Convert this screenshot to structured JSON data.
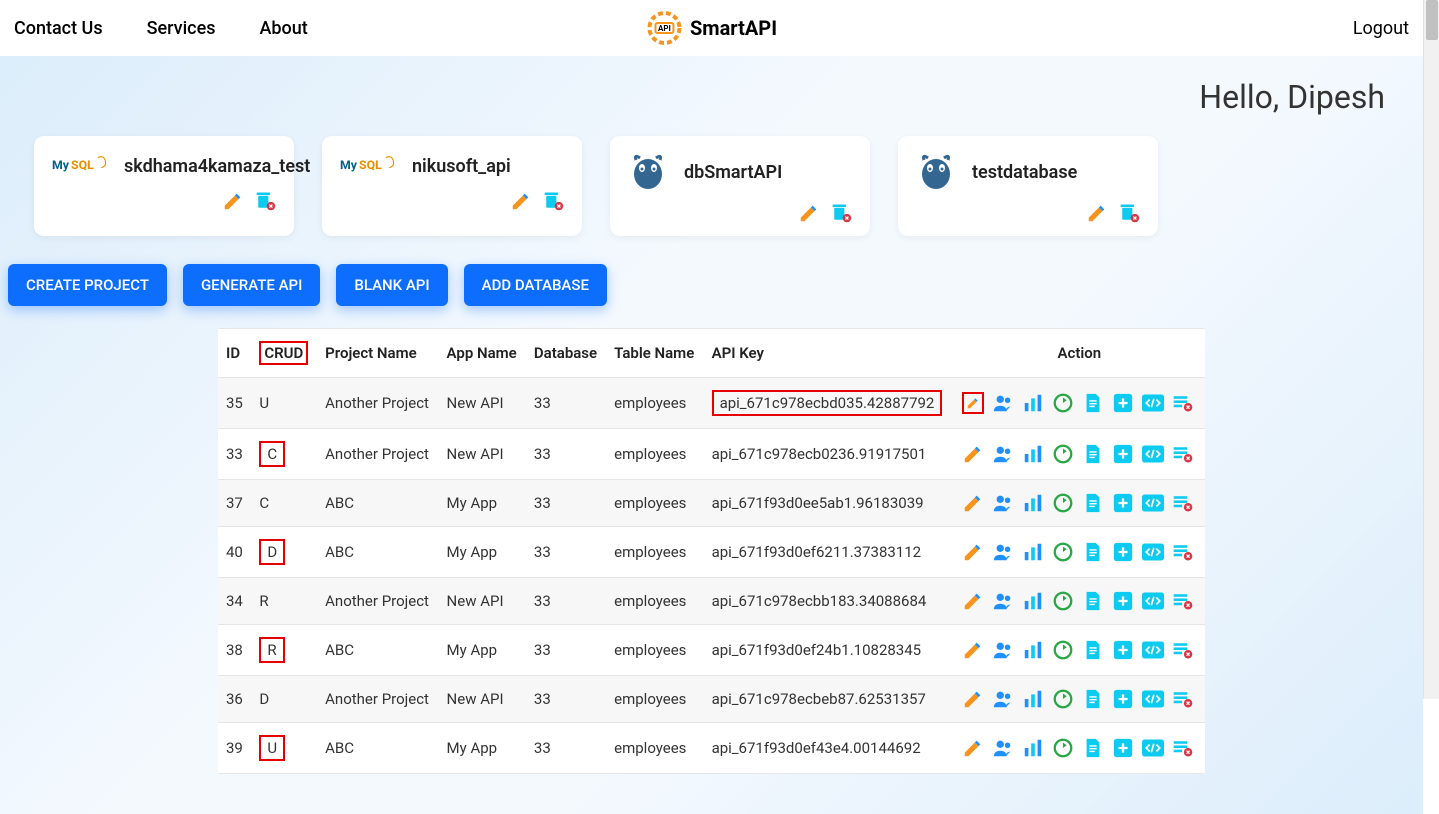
{
  "nav": {
    "contact": "Contact Us",
    "services": "Services",
    "about": "About",
    "brand": "SmartAPI",
    "brand_badge": "API",
    "logout": "Logout"
  },
  "greeting": "Hello, Dipesh",
  "db_cards": [
    {
      "name": "skdhama4kamaza_test",
      "engine": "mysql"
    },
    {
      "name": "nikusoft_api",
      "engine": "mysql"
    },
    {
      "name": "dbSmartAPI",
      "engine": "postgres"
    },
    {
      "name": "testdatabase",
      "engine": "postgres"
    }
  ],
  "buttons": {
    "create_project": "CREATE PROJECT",
    "generate_api": "GENERATE API",
    "blank_api": "BLANK API",
    "add_database": "ADD DATABASE"
  },
  "table": {
    "headers": {
      "id": "ID",
      "crud": "CRUD",
      "project": "Project Name",
      "app": "App Name",
      "database": "Database",
      "table": "Table Name",
      "apikey": "API Key",
      "action": "Action"
    },
    "rows": [
      {
        "id": "35",
        "crud": "U",
        "crud_hl": false,
        "project": "Another Project",
        "app": "New API",
        "db": "33",
        "table": "employees",
        "apikey": "api_671c978ecbd035.42887792",
        "apikey_hl": true,
        "edit_hl": true
      },
      {
        "id": "33",
        "crud": "C",
        "crud_hl": true,
        "project": "Another Project",
        "app": "New API",
        "db": "33",
        "table": "employees",
        "apikey": "api_671c978ecb0236.91917501",
        "apikey_hl": false,
        "edit_hl": false
      },
      {
        "id": "37",
        "crud": "C",
        "crud_hl": false,
        "project": "ABC",
        "app": "My App",
        "db": "33",
        "table": "employees",
        "apikey": "api_671f93d0ee5ab1.96183039",
        "apikey_hl": false,
        "edit_hl": false
      },
      {
        "id": "40",
        "crud": "D",
        "crud_hl": true,
        "project": "ABC",
        "app": "My App",
        "db": "33",
        "table": "employees",
        "apikey": "api_671f93d0ef6211.37383112",
        "apikey_hl": false,
        "edit_hl": false
      },
      {
        "id": "34",
        "crud": "R",
        "crud_hl": false,
        "project": "Another Project",
        "app": "New API",
        "db": "33",
        "table": "employees",
        "apikey": "api_671c978ecbb183.34088684",
        "apikey_hl": false,
        "edit_hl": false
      },
      {
        "id": "38",
        "crud": "R",
        "crud_hl": true,
        "project": "ABC",
        "app": "My App",
        "db": "33",
        "table": "employees",
        "apikey": "api_671f93d0ef24b1.10828345",
        "apikey_hl": false,
        "edit_hl": false
      },
      {
        "id": "36",
        "crud": "D",
        "crud_hl": false,
        "project": "Another Project",
        "app": "New API",
        "db": "33",
        "table": "employees",
        "apikey": "api_671c978ecbeb87.62531357",
        "apikey_hl": false,
        "edit_hl": false
      },
      {
        "id": "39",
        "crud": "U",
        "crud_hl": true,
        "project": "ABC",
        "app": "My App",
        "db": "33",
        "table": "employees",
        "apikey": "api_671f93d0ef43e4.00144692",
        "apikey_hl": false,
        "edit_hl": false
      }
    ]
  },
  "icons": {
    "edit": "edit-icon",
    "delete_db": "trash-icon"
  },
  "colors": {
    "primary": "#0d6efd",
    "highlight": "#e60000",
    "orange": "#f7941d",
    "cyan": "#0dcaf0",
    "green": "#28a745",
    "link_blue": "#1e90ff"
  }
}
